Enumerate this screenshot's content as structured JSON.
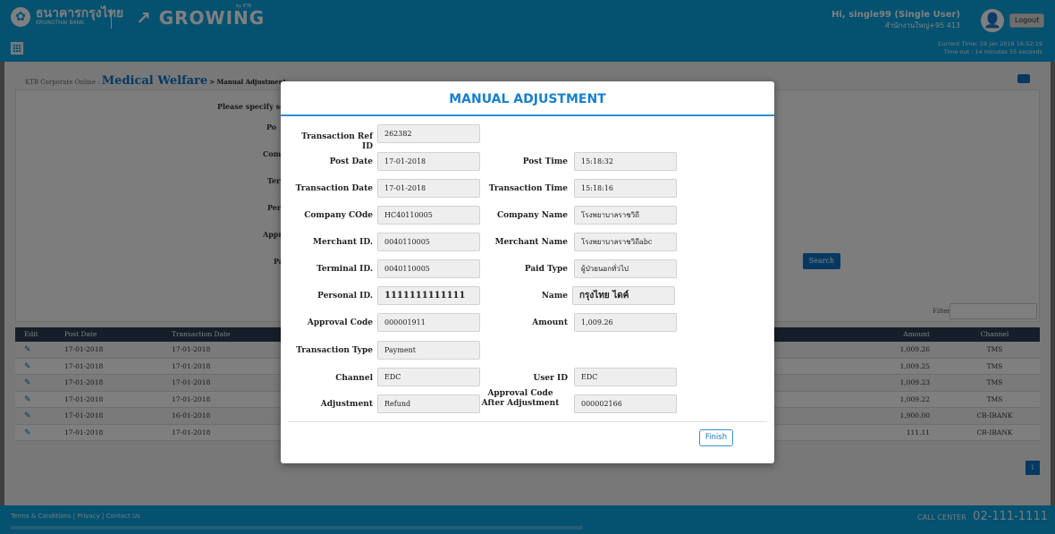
{
  "header": {
    "bank_name": "ธนาคารกรุงไทย",
    "bank_name_en": "KRUNGTHAI BANK",
    "app_logo": "GROWING",
    "app_logo_by": "by KTB",
    "user_greeting": "Hi, single99 (Single User)",
    "user_branch": "สำนักงานใหญ่+95 413",
    "logout_label": "Logout",
    "current_time": "Current Time: 19 Jan 2018 16:52:19",
    "timeout": "Time out : 14 minutes 55 seconds"
  },
  "breadcrumb": {
    "root": "KTB Corporate Online :",
    "section": "Medical Welfare",
    "sep": ">",
    "page": "Manual Adjustment"
  },
  "search_form": {
    "prompt": "Please specify search",
    "side_labels": [
      "Po",
      "Compa",
      "Terr",
      "Pers",
      "Approv",
      "Pa"
    ],
    "search_label": "Search",
    "filter_label": "Filter:"
  },
  "table": {
    "headers": [
      "Edit",
      "Post Date",
      "Transaction Date",
      "Amount",
      "Channel"
    ],
    "rows": [
      {
        "post_date": "17-01-2018",
        "trans_date": "17-01-2018",
        "amount": "1,009.26",
        "channel": "TMS"
      },
      {
        "post_date": "17-01-2018",
        "trans_date": "17-01-2018",
        "amount": "1,009.25",
        "channel": "TMS"
      },
      {
        "post_date": "17-01-2018",
        "trans_date": "17-01-2018",
        "amount": "1,009.23",
        "channel": "TMS"
      },
      {
        "post_date": "17-01-2018",
        "trans_date": "17-01-2018",
        "amount": "1,009.22",
        "channel": "TMS"
      },
      {
        "post_date": "17-01-2018",
        "trans_date": "16-01-2018",
        "amount": "1,900.00",
        "channel": "CB-IBANK"
      },
      {
        "post_date": "17-01-2018",
        "trans_date": "17-01-2018",
        "amount": "111.11",
        "channel": "CB-IBANK"
      }
    ],
    "page_number": "1"
  },
  "footer": {
    "links": "Terms & Conditions  |  Privacy  |  Contact Us",
    "call_center_label": "CALL CENTER",
    "call_center_number": "02-111-1111"
  },
  "modal": {
    "title": "MANUAL ADJUSTMENT",
    "fields": {
      "transaction_ref_id": {
        "label": "Transaction Ref ID",
        "value": "262382"
      },
      "post_date": {
        "label": "Post Date",
        "value": "17-01-2018"
      },
      "post_time": {
        "label": "Post Time",
        "value": "15:18:32"
      },
      "transaction_date": {
        "label": "Transaction Date",
        "value": "17-01-2018"
      },
      "transaction_time": {
        "label": "Transaction Time",
        "value": "15:18:16"
      },
      "company_code": {
        "label": "Company COde",
        "value": "HC40110005"
      },
      "company_name": {
        "label": "Company Name",
        "value": "โรงพยาบาลราชวิถี"
      },
      "merchant_id": {
        "label": "Merchant ID.",
        "value": "0040110005"
      },
      "merchant_name": {
        "label": "Merchant Name",
        "value": "โรงพยาบาลราชวิถีabc"
      },
      "terminal_id": {
        "label": "Terminal ID.",
        "value": "0040110005"
      },
      "paid_type": {
        "label": "Paid Type",
        "value": "ผู้ป่วยนอกทั่วไป"
      },
      "personal_id": {
        "label": "Personal ID.",
        "value": "1111111111111"
      },
      "name": {
        "label": "Name",
        "value": "กรุงไทย ไดค์"
      },
      "approval_code": {
        "label": "Approval Code",
        "value": "000001911"
      },
      "amount": {
        "label": "Amount",
        "value": "1,009.26"
      },
      "transaction_type": {
        "label": "Transaction Type",
        "value": "Payment"
      },
      "channel": {
        "label": "Channel",
        "value": "EDC"
      },
      "user_id": {
        "label": "User ID",
        "value": "EDC"
      },
      "adjustment": {
        "label": "Adjustment",
        "value": "Refund"
      },
      "approval_code_after": {
        "label_line1": "Approval Code",
        "label_line2": "After Adjustment",
        "value": "000002166"
      }
    },
    "finish_label": "Finish"
  }
}
